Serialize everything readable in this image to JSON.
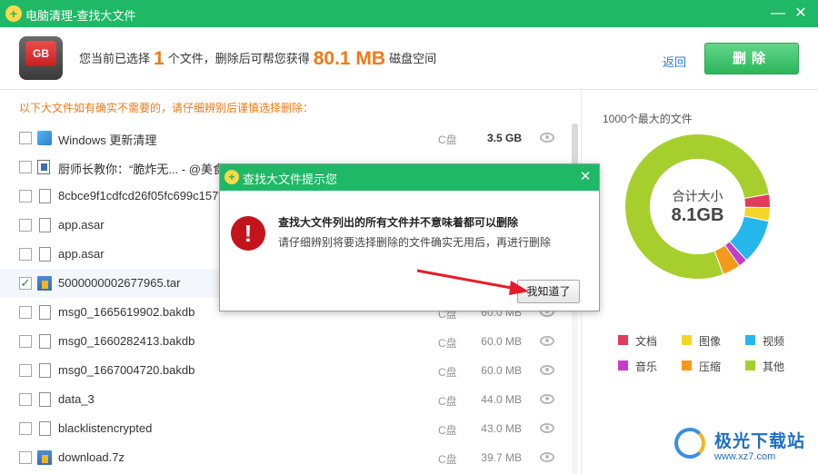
{
  "window": {
    "title": "电脑清理-查找大文件",
    "minimize_glyph": "—",
    "close_glyph": "✕"
  },
  "summary": {
    "icon_text": "GB",
    "prefix": "您当前已选择",
    "count": "1",
    "mid": "个文件，删除后可帮您获得",
    "amount": "80.1 MB",
    "suffix": "磁盘空间",
    "back_label": "返回",
    "delete_label": "删除"
  },
  "notice": "以下大文件如有确实不需要的，请仔细辨别后谨慎选择删除：",
  "files": [
    {
      "name": "Windows 更新清理",
      "drive": "C盘",
      "size": "3.5 GB",
      "checked": false,
      "icon": "winupd-icon"
    },
    {
      "name": "厨师长教你：“脆炸无... - @美食",
      "drive": "",
      "size": "",
      "checked": false,
      "icon": "video-icon"
    },
    {
      "name": "8cbce9f1cdfcd26f05fc699c157f",
      "drive": "",
      "size": "",
      "checked": false,
      "icon": "doc-icon"
    },
    {
      "name": "app.asar",
      "drive": "",
      "size": "",
      "checked": false,
      "icon": "doc-icon"
    },
    {
      "name": "app.asar",
      "drive": "",
      "size": "",
      "checked": false,
      "icon": "doc-icon"
    },
    {
      "name": "5000000002677965.tar",
      "drive": "",
      "size": "",
      "checked": true,
      "icon": "archive-icon"
    },
    {
      "name": "msg0_1665619902.bakdb",
      "drive": "C盘",
      "size": "60.0 MB",
      "checked": false,
      "icon": "doc-icon"
    },
    {
      "name": "msg0_1660282413.bakdb",
      "drive": "C盘",
      "size": "60.0 MB",
      "checked": false,
      "icon": "doc-icon"
    },
    {
      "name": "msg0_1667004720.bakdb",
      "drive": "C盘",
      "size": "60.0 MB",
      "checked": false,
      "icon": "doc-icon"
    },
    {
      "name": "data_3",
      "drive": "C盘",
      "size": "44.0 MB",
      "checked": false,
      "icon": "doc-icon"
    },
    {
      "name": "blacklistencrypted",
      "drive": "C盘",
      "size": "43.0 MB",
      "checked": false,
      "icon": "doc-icon"
    },
    {
      "name": "download.7z",
      "drive": "C盘",
      "size": "39.7 MB",
      "checked": false,
      "icon": "archive-icon"
    }
  ],
  "right_panel": {
    "title": "1000个最大的文件",
    "total_label": "合计大小",
    "total_value": "8.1GB"
  },
  "chart_data": {
    "type": "pie",
    "title": "1000个最大的文件",
    "center_label": "合计大小",
    "center_value": "8.1GB",
    "categories": [
      "文档",
      "图像",
      "视频",
      "音乐",
      "压缩",
      "其他"
    ],
    "colors": [
      "#e23b5b",
      "#f4d52a",
      "#25b6ec",
      "#c33ec6",
      "#f39a1d",
      "#a6cf2e"
    ],
    "values": [
      3,
      3,
      10,
      2,
      4,
      78
    ]
  },
  "dialog": {
    "title": "查找大文件提示您",
    "close_glyph": "✕",
    "warn_glyph": "!",
    "line1": "查找大文件列出的所有文件并不意味着都可以删除",
    "line2": "请仔细辨别将要选择删除的文件确实无用后，再进行删除",
    "ok_label": "我知道了"
  },
  "watermark": {
    "brand": "极光下载站",
    "url": "www.xz7.com"
  }
}
